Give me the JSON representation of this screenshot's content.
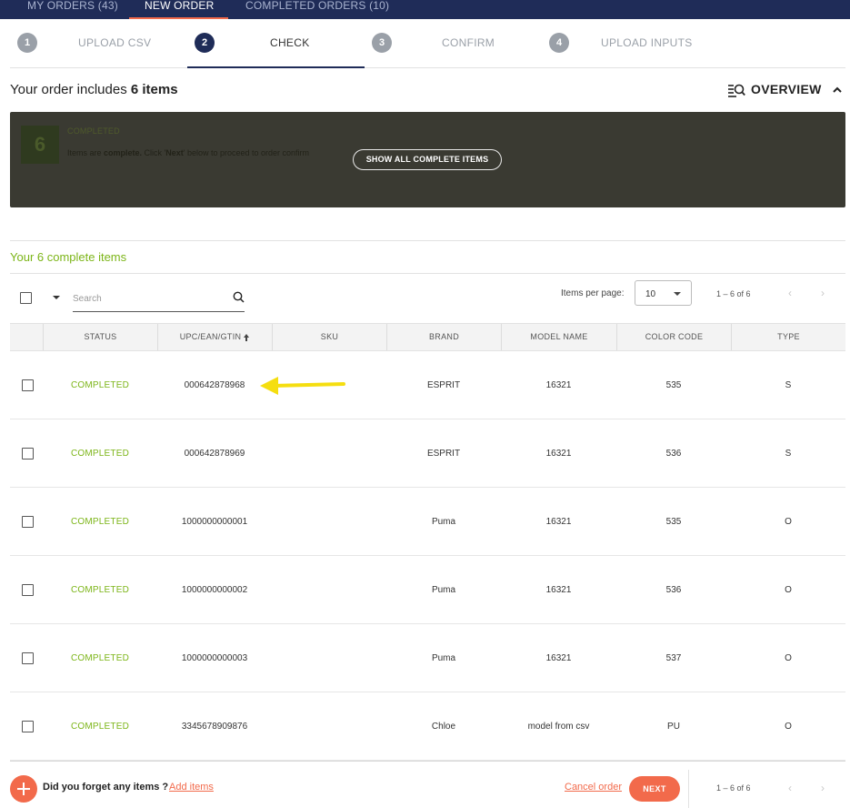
{
  "topnav": {
    "tabs": [
      {
        "label": "MY ORDERS (43)"
      },
      {
        "label": "NEW ORDER"
      },
      {
        "label": "COMPLETED ORDERS (10)"
      }
    ]
  },
  "stepper": {
    "steps": [
      {
        "num": "1",
        "label": "UPLOAD CSV"
      },
      {
        "num": "2",
        "label": "CHECK"
      },
      {
        "num": "3",
        "label": "CONFIRM"
      },
      {
        "num": "4",
        "label": "UPLOAD INPUTS"
      }
    ],
    "active_step": 2
  },
  "summary": {
    "prefix": "Your order includes ",
    "count": "6 items",
    "overview_label": "OVERVIEW"
  },
  "panel": {
    "count": "6",
    "status": "COMPLETED",
    "info_pre": "Items are ",
    "info_bold": "complete.",
    "info_mid": " Click '",
    "info_next": "Next",
    "info_post": "' below to proceed to order confirm",
    "show_button": "SHOW ALL COMPLETE ITEMS"
  },
  "complete_heading": "Your 6 complete items",
  "toolbar": {
    "search_placeholder": "Search",
    "items_per_page_label": "Items per page:",
    "items_per_page_value": "10",
    "range": "1 – 6 of 6",
    "prev_glyph": "‹",
    "next_glyph": "›"
  },
  "table": {
    "columns": [
      "STATUS",
      "UPC/EAN/GTIN",
      "SKU",
      "BRAND",
      "MODEL NAME",
      "COLOR CODE",
      "TYPE"
    ],
    "rows": [
      {
        "status": "COMPLETED",
        "upc": "000642878968",
        "sku": "",
        "brand": "ESPRIT",
        "model": "16321",
        "color": "535",
        "type": "S"
      },
      {
        "status": "COMPLETED",
        "upc": "000642878969",
        "sku": "",
        "brand": "ESPRIT",
        "model": "16321",
        "color": "536",
        "type": "S"
      },
      {
        "status": "COMPLETED",
        "upc": "1000000000001",
        "sku": "",
        "brand": "Puma",
        "model": "16321",
        "color": "535",
        "type": "O"
      },
      {
        "status": "COMPLETED",
        "upc": "1000000000002",
        "sku": "",
        "brand": "Puma",
        "model": "16321",
        "color": "536",
        "type": "O"
      },
      {
        "status": "COMPLETED",
        "upc": "1000000000003",
        "sku": "",
        "brand": "Puma",
        "model": "16321",
        "color": "537",
        "type": "O"
      },
      {
        "status": "COMPLETED",
        "upc": "3345678909876",
        "sku": "",
        "brand": "Chloe",
        "model": "model from csv",
        "color": "PU",
        "type": "O"
      }
    ]
  },
  "footer": {
    "forgot_text": "Did you forget any items ?",
    "add_items": "Add items",
    "cancel_order": "Cancel order",
    "next_button": "NEXT",
    "range": "1 – 6 of 6"
  },
  "colors": {
    "navy": "#1f2c58",
    "accent": "#f26a4b",
    "status_green": "#7cb518",
    "annotation_yellow": "#f5de10"
  }
}
